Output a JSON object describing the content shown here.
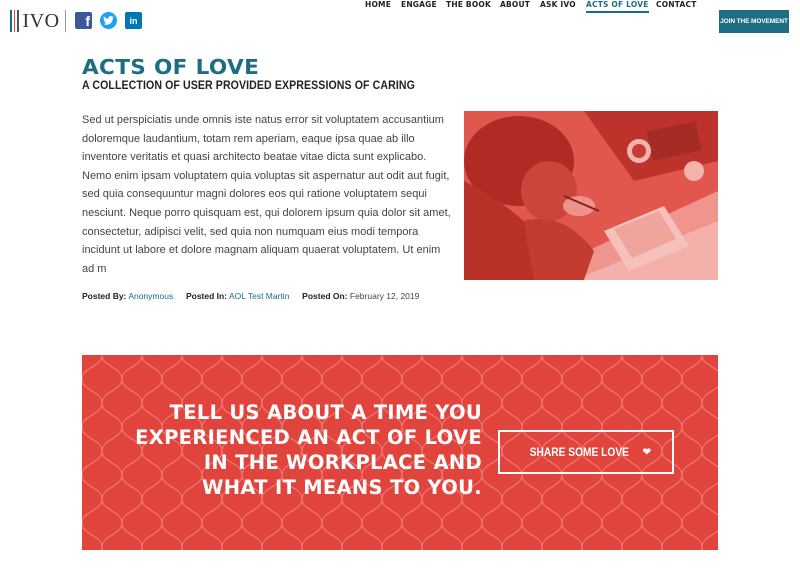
{
  "header": {
    "logo_text": "IVO",
    "logo_bar_colors": [
      "#1d6d84",
      "#e0443c",
      "#555555"
    ],
    "social": [
      {
        "name": "facebook",
        "glyph": "f",
        "color": "#3b5998"
      },
      {
        "name": "twitter",
        "glyph": "t",
        "color": "#1da1f2"
      },
      {
        "name": "linkedin",
        "glyph": "in",
        "color": "#0077b5"
      }
    ],
    "nav": [
      {
        "label": "HOME",
        "active": false
      },
      {
        "label": "ENGAGE",
        "active": false
      },
      {
        "label": "THE BOOK",
        "active": false
      },
      {
        "label": "ABOUT",
        "active": false
      },
      {
        "label": "ASK IVO",
        "active": false
      },
      {
        "label": "ACTS OF LOVE",
        "active": true
      },
      {
        "label": "CONTACT",
        "active": false
      }
    ],
    "join_label": "JOIN THE MOVEMENT"
  },
  "page": {
    "title": "ACTS OF LOVE",
    "subtitle": "A COLLECTION OF USER PROVIDED EXPRESSIONS OF CARING",
    "body": "Sed ut perspiciatis unde omnis iste natus error sit voluptatem accusantium doloremque laudantium, totam rem aperiam, eaque ipsa quae ab illo inventore veritatis et quasi architecto beatae vitae dicta sunt explicabo. Nemo enim ipsam voluptatem quia voluptas sit aspernatur aut odit aut fugit, sed quia consequuntur magni dolores eos qui ratione voluptatem sequi nesciunt. Neque porro quisquam est, qui dolorem ipsum quia dolor sit amet, consectetur, adipisci velit, sed quia non numquam eius modi tempora incidunt ut labore et dolore magnam aliquam quaerat voluptatem. Ut enim ad m",
    "meta": {
      "posted_by_label": "Posted By:",
      "posted_by": "Anonymous",
      "posted_in_label": "Posted In:",
      "posted_in": "AOL Test Martin",
      "posted_on_label": "Posted On:",
      "posted_on": "February 12, 2019"
    }
  },
  "cta": {
    "lines": [
      "TELL US ABOUT A TIME YOU",
      "EXPERIENCED AN ACT OF LOVE",
      "IN THE WORKPLACE AND",
      "WHAT IT MEANS TO YOU."
    ],
    "button_label": "SHARE SOME LOVE",
    "button_icon": "heart-icon"
  },
  "colors": {
    "brand": "#1d6d84",
    "cta_red": "#e0443c"
  }
}
